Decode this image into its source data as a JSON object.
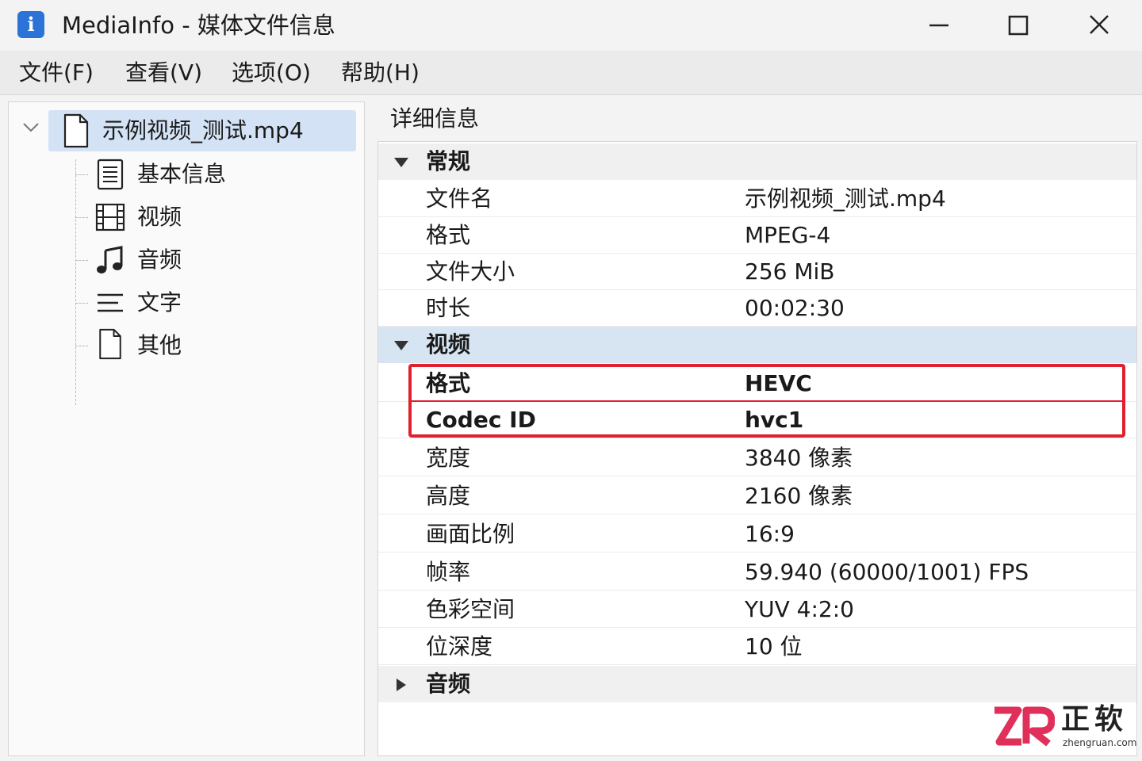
{
  "window": {
    "icon_letter": "i",
    "title": "MediaInfo  -  媒体文件信息"
  },
  "menu": [
    {
      "label": "文件(F)"
    },
    {
      "label": "查看(V)"
    },
    {
      "label": "选项(O)"
    },
    {
      "label": "帮助(H)"
    }
  ],
  "tree": {
    "root": {
      "label": "示例视频_测试.mp4",
      "icon": "file-icon",
      "expanded": true
    },
    "children": [
      {
        "label": "基本信息",
        "icon": "document-lines-icon"
      },
      {
        "label": "视频",
        "icon": "film-icon"
      },
      {
        "label": "音频",
        "icon": "music-note-icon"
      },
      {
        "label": "文字",
        "icon": "text-lines-icon"
      },
      {
        "label": "其他",
        "icon": "file-icon"
      }
    ]
  },
  "details": {
    "header": "详细信息",
    "sections": [
      {
        "title": "常规",
        "expanded": true,
        "rows": [
          {
            "key": "文件名",
            "value": "示例视频_测试.mp4"
          },
          {
            "key": "格式",
            "value": "MPEG-4"
          },
          {
            "key": "文件大小",
            "value": "256 MiB"
          },
          {
            "key": "时长",
            "value": "00:02:30"
          }
        ]
      },
      {
        "title": "视频",
        "expanded": true,
        "selected": true,
        "rows": [
          {
            "key": "格式",
            "value": "HEVC",
            "highlighted": true
          },
          {
            "key": "Codec ID",
            "value": "hvc1",
            "highlighted": true
          },
          {
            "key": "宽度",
            "value": "3840 像素"
          },
          {
            "key": "高度",
            "value": "2160 像素"
          },
          {
            "key": "画面比例",
            "value": "16:9"
          },
          {
            "key": "帧率",
            "value": "59.940 (60000/1001) FPS"
          },
          {
            "key": "色彩空间",
            "value": "YUV 4:2:0"
          },
          {
            "key": "位深度",
            "value": "10 位"
          }
        ]
      },
      {
        "title": "音频",
        "expanded": false,
        "rows": []
      }
    ]
  },
  "watermark": {
    "brand_cn": "正软",
    "brand_en": "zhengruan.com"
  },
  "colors": {
    "highlight": "#e0202e",
    "selection": "#d3e3f5",
    "app_icon": "#2b73d6"
  }
}
